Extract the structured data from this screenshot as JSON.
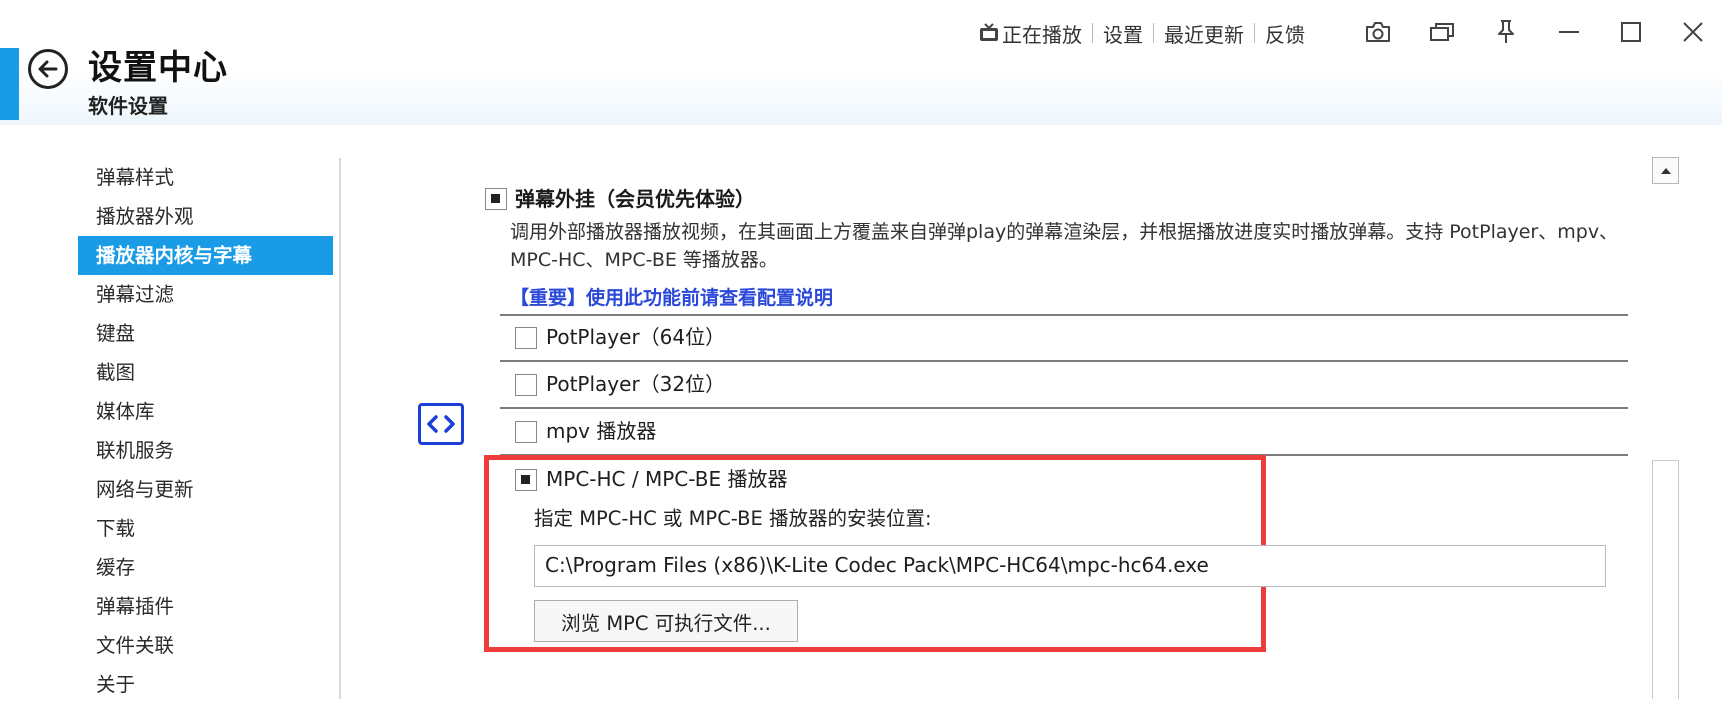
{
  "header": {
    "title": "设置中心",
    "subtitle": "软件设置",
    "top_links": {
      "now_playing": "正在播放",
      "settings": "设置",
      "recent_updates": "最近更新",
      "feedback": "反馈"
    },
    "window_controls": [
      "camera-icon",
      "restore-window-icon",
      "pin-icon",
      "minimize-icon",
      "maximize-icon",
      "close-icon"
    ]
  },
  "sidebar": {
    "items": [
      {
        "label": "弹幕样式"
      },
      {
        "label": "播放器外观"
      },
      {
        "label": "播放器内核与字幕",
        "active": true
      },
      {
        "label": "弹幕过滤"
      },
      {
        "label": "键盘"
      },
      {
        "label": "截图"
      },
      {
        "label": "媒体库"
      },
      {
        "label": "联机服务"
      },
      {
        "label": "网络与更新"
      },
      {
        "label": "下载"
      },
      {
        "label": "缓存"
      },
      {
        "label": "弹幕插件"
      },
      {
        "label": "文件关联"
      },
      {
        "label": "关于"
      }
    ]
  },
  "main": {
    "external_danmaku": {
      "title": "弹幕外挂（会员优先体验）",
      "checked": true,
      "description": "调用外部播放器播放视频，在其画面上方覆盖来自弹弹play的弹幕渲染层，并根据播放进度实时播放弹幕。支持 PotPlayer、mpv、MPC-HC、MPC-BE 等播放器。",
      "important_link": "【重要】使用此功能前请查看配置说明",
      "options": [
        {
          "label": "PotPlayer（64位）",
          "checked": false
        },
        {
          "label": "PotPlayer（32位）",
          "checked": false
        },
        {
          "label": "mpv 播放器",
          "checked": false
        },
        {
          "label": "MPC-HC / MPC-BE 播放器",
          "checked": true
        }
      ],
      "mpc": {
        "path_label": "指定 MPC-HC 或 MPC-BE 播放器的安装位置:",
        "path_value": "C:\\Program Files (x86)\\K-Lite Codec Pack\\MPC-HC64\\mpc-hc64.exe",
        "browse_button": "浏览 MPC 可执行文件..."
      }
    }
  },
  "colors": {
    "accent": "#1a9be6",
    "link": "#2b49d8",
    "highlight_border": "#ee3b3b",
    "code_icon": "#1a3fd6"
  }
}
